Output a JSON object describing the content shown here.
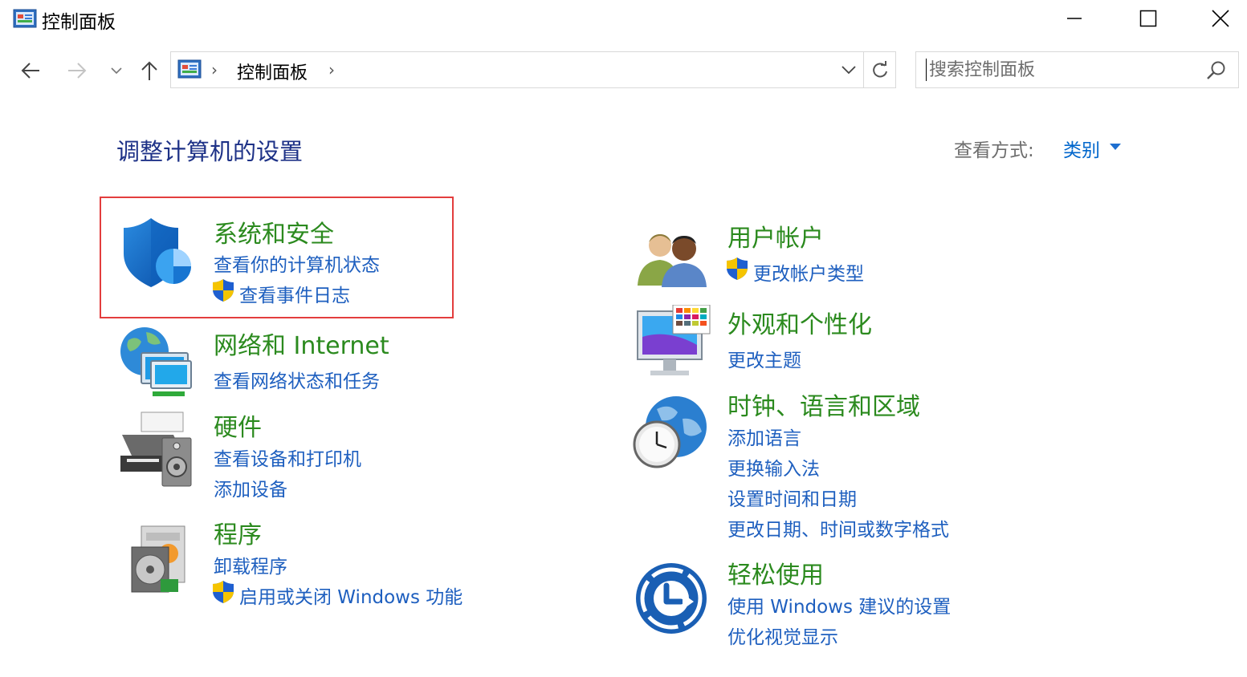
{
  "window": {
    "title": "控制面板"
  },
  "address": {
    "crumbs": [
      "控制面板"
    ],
    "separator": "›"
  },
  "search": {
    "placeholder": "搜索控制面板"
  },
  "header": {
    "title": "调整计算机的设置",
    "view_label": "查看方式:",
    "view_value": "类别"
  },
  "categories": [
    {
      "title": "系统和安全",
      "links": [
        "查看你的计算机状态",
        "查看事件日志"
      ],
      "highlighted": true
    },
    {
      "title": "网络和 Internet",
      "links": [
        "查看网络状态和任务"
      ]
    },
    {
      "title": "硬件",
      "links": [
        "查看设备和打印机",
        "添加设备"
      ]
    },
    {
      "title": "程序",
      "links": [
        "卸载程序",
        "启用或关闭 Windows 功能"
      ]
    },
    {
      "title": "用户帐户",
      "links": [
        "更改帐户类型"
      ]
    },
    {
      "title": "外观和个性化",
      "links": [
        "更改主题"
      ]
    },
    {
      "title": "时钟、语言和区域",
      "links": [
        "添加语言",
        "更换输入法",
        "设置时间和日期",
        "更改日期、时间或数字格式"
      ]
    },
    {
      "title": "轻松使用",
      "links": [
        "使用 Windows 建议的设置",
        "优化视觉显示"
      ]
    }
  ],
  "colors": {
    "category_title": "#2b8a1e",
    "link": "#1e5fbf",
    "page_title": "#1e3287",
    "highlight_border": "#e33d3d"
  }
}
